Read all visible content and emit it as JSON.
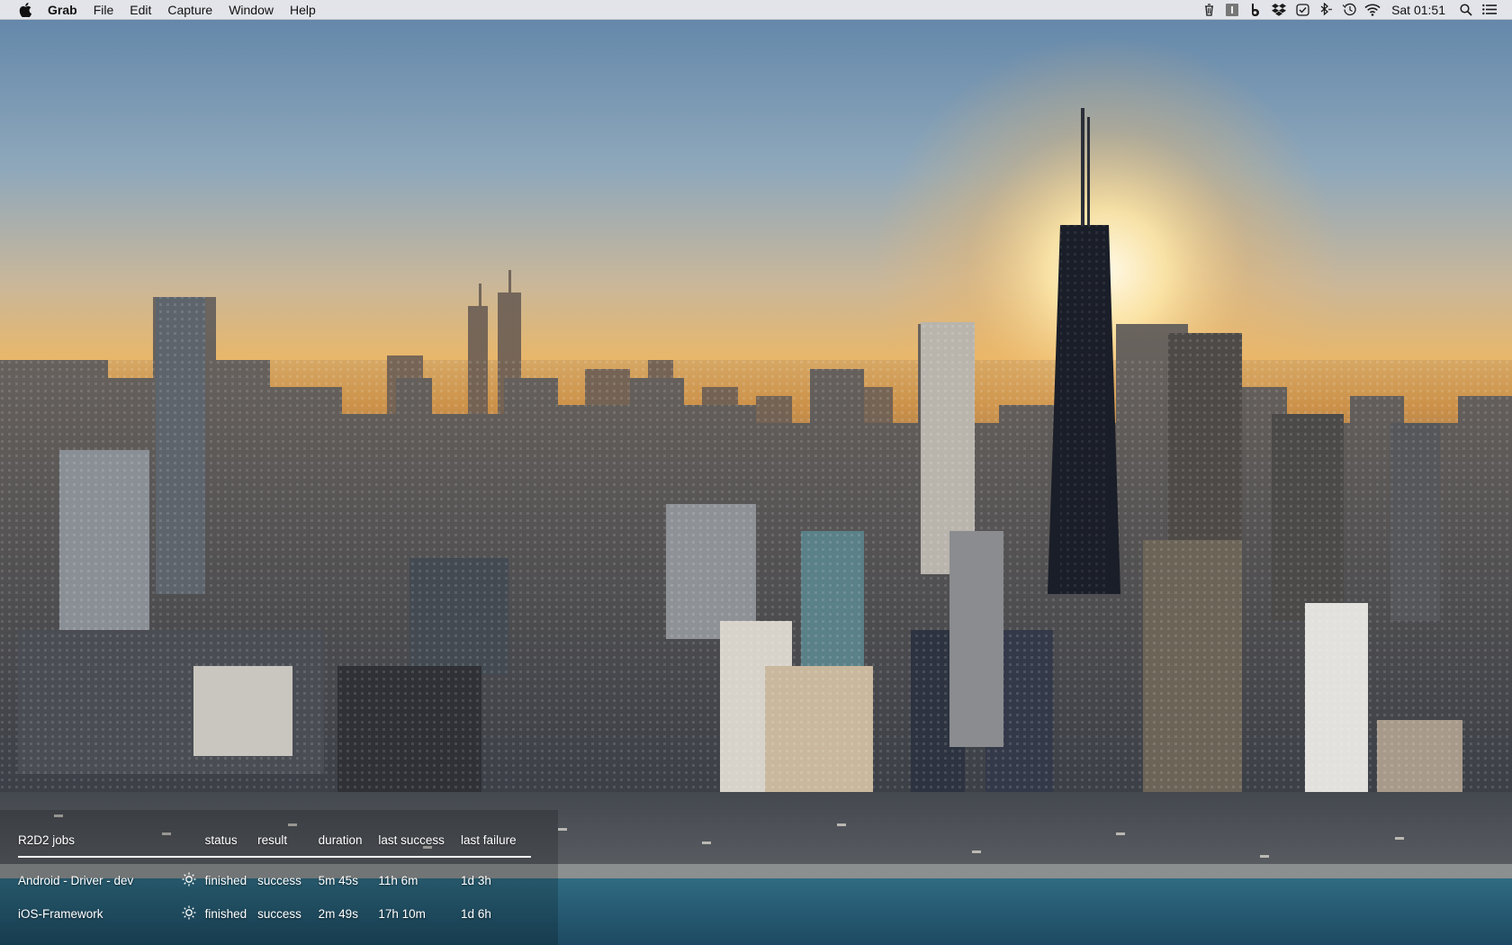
{
  "menubar": {
    "apple_icon": "apple-icon",
    "app_name": "Grab",
    "menus": [
      "File",
      "Edit",
      "Capture",
      "Window",
      "Help"
    ],
    "status_icons": [
      "trash-icon",
      "info-icon",
      "bing-icon",
      "dropbox-icon",
      "check-icon",
      "bluetooth-icon",
      "time-machine-icon",
      "wifi-icon"
    ],
    "clock": "Sat 01:51",
    "spotlight_icon": "search-icon",
    "notification_icon": "list-icon"
  },
  "jobs_widget": {
    "title": "R2D2 jobs",
    "columns": [
      "status",
      "result",
      "duration",
      "last success",
      "last failure"
    ],
    "rows": [
      {
        "name": "Android - Driver - dev",
        "icon": "sun-icon",
        "status": "finished",
        "result": "success",
        "duration": "5m 45s",
        "last_success": "11h 6m",
        "last_failure": "1d 3h"
      },
      {
        "name": "iOS-Framework",
        "icon": "sun-icon",
        "status": "finished",
        "result": "success",
        "duration": "2m 49s",
        "last_success": "17h 10m",
        "last_failure": "1d 6h"
      }
    ]
  }
}
